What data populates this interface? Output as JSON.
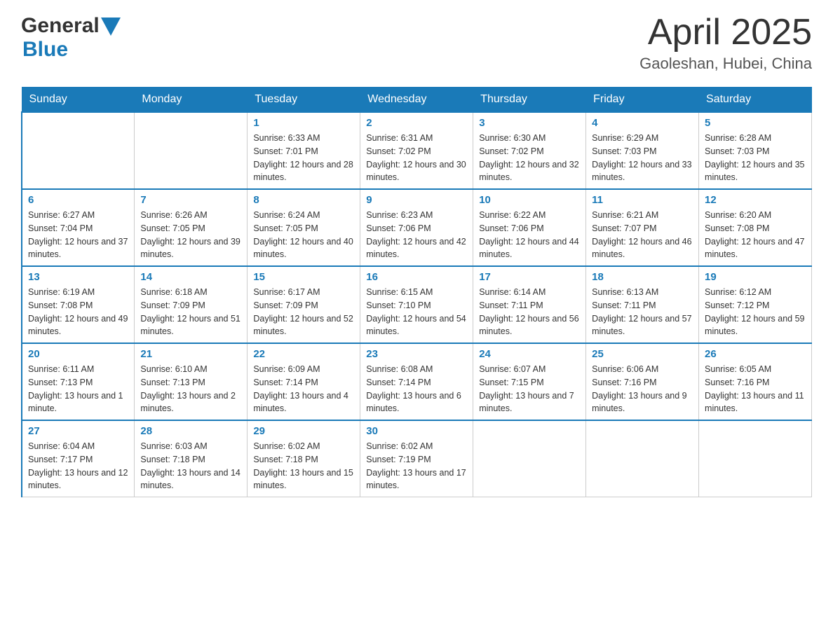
{
  "header": {
    "logo_general": "General",
    "logo_blue": "Blue",
    "title": "April 2025",
    "subtitle": "Gaoleshan, Hubei, China"
  },
  "days_of_week": [
    "Sunday",
    "Monday",
    "Tuesday",
    "Wednesday",
    "Thursday",
    "Friday",
    "Saturday"
  ],
  "weeks": [
    [
      {
        "day": "",
        "sunrise": "",
        "sunset": "",
        "daylight": ""
      },
      {
        "day": "",
        "sunrise": "",
        "sunset": "",
        "daylight": ""
      },
      {
        "day": "1",
        "sunrise": "Sunrise: 6:33 AM",
        "sunset": "Sunset: 7:01 PM",
        "daylight": "Daylight: 12 hours and 28 minutes."
      },
      {
        "day": "2",
        "sunrise": "Sunrise: 6:31 AM",
        "sunset": "Sunset: 7:02 PM",
        "daylight": "Daylight: 12 hours and 30 minutes."
      },
      {
        "day": "3",
        "sunrise": "Sunrise: 6:30 AM",
        "sunset": "Sunset: 7:02 PM",
        "daylight": "Daylight: 12 hours and 32 minutes."
      },
      {
        "day": "4",
        "sunrise": "Sunrise: 6:29 AM",
        "sunset": "Sunset: 7:03 PM",
        "daylight": "Daylight: 12 hours and 33 minutes."
      },
      {
        "day": "5",
        "sunrise": "Sunrise: 6:28 AM",
        "sunset": "Sunset: 7:03 PM",
        "daylight": "Daylight: 12 hours and 35 minutes."
      }
    ],
    [
      {
        "day": "6",
        "sunrise": "Sunrise: 6:27 AM",
        "sunset": "Sunset: 7:04 PM",
        "daylight": "Daylight: 12 hours and 37 minutes."
      },
      {
        "day": "7",
        "sunrise": "Sunrise: 6:26 AM",
        "sunset": "Sunset: 7:05 PM",
        "daylight": "Daylight: 12 hours and 39 minutes."
      },
      {
        "day": "8",
        "sunrise": "Sunrise: 6:24 AM",
        "sunset": "Sunset: 7:05 PM",
        "daylight": "Daylight: 12 hours and 40 minutes."
      },
      {
        "day": "9",
        "sunrise": "Sunrise: 6:23 AM",
        "sunset": "Sunset: 7:06 PM",
        "daylight": "Daylight: 12 hours and 42 minutes."
      },
      {
        "day": "10",
        "sunrise": "Sunrise: 6:22 AM",
        "sunset": "Sunset: 7:06 PM",
        "daylight": "Daylight: 12 hours and 44 minutes."
      },
      {
        "day": "11",
        "sunrise": "Sunrise: 6:21 AM",
        "sunset": "Sunset: 7:07 PM",
        "daylight": "Daylight: 12 hours and 46 minutes."
      },
      {
        "day": "12",
        "sunrise": "Sunrise: 6:20 AM",
        "sunset": "Sunset: 7:08 PM",
        "daylight": "Daylight: 12 hours and 47 minutes."
      }
    ],
    [
      {
        "day": "13",
        "sunrise": "Sunrise: 6:19 AM",
        "sunset": "Sunset: 7:08 PM",
        "daylight": "Daylight: 12 hours and 49 minutes."
      },
      {
        "day": "14",
        "sunrise": "Sunrise: 6:18 AM",
        "sunset": "Sunset: 7:09 PM",
        "daylight": "Daylight: 12 hours and 51 minutes."
      },
      {
        "day": "15",
        "sunrise": "Sunrise: 6:17 AM",
        "sunset": "Sunset: 7:09 PM",
        "daylight": "Daylight: 12 hours and 52 minutes."
      },
      {
        "day": "16",
        "sunrise": "Sunrise: 6:15 AM",
        "sunset": "Sunset: 7:10 PM",
        "daylight": "Daylight: 12 hours and 54 minutes."
      },
      {
        "day": "17",
        "sunrise": "Sunrise: 6:14 AM",
        "sunset": "Sunset: 7:11 PM",
        "daylight": "Daylight: 12 hours and 56 minutes."
      },
      {
        "day": "18",
        "sunrise": "Sunrise: 6:13 AM",
        "sunset": "Sunset: 7:11 PM",
        "daylight": "Daylight: 12 hours and 57 minutes."
      },
      {
        "day": "19",
        "sunrise": "Sunrise: 6:12 AM",
        "sunset": "Sunset: 7:12 PM",
        "daylight": "Daylight: 12 hours and 59 minutes."
      }
    ],
    [
      {
        "day": "20",
        "sunrise": "Sunrise: 6:11 AM",
        "sunset": "Sunset: 7:13 PM",
        "daylight": "Daylight: 13 hours and 1 minute."
      },
      {
        "day": "21",
        "sunrise": "Sunrise: 6:10 AM",
        "sunset": "Sunset: 7:13 PM",
        "daylight": "Daylight: 13 hours and 2 minutes."
      },
      {
        "day": "22",
        "sunrise": "Sunrise: 6:09 AM",
        "sunset": "Sunset: 7:14 PM",
        "daylight": "Daylight: 13 hours and 4 minutes."
      },
      {
        "day": "23",
        "sunrise": "Sunrise: 6:08 AM",
        "sunset": "Sunset: 7:14 PM",
        "daylight": "Daylight: 13 hours and 6 minutes."
      },
      {
        "day": "24",
        "sunrise": "Sunrise: 6:07 AM",
        "sunset": "Sunset: 7:15 PM",
        "daylight": "Daylight: 13 hours and 7 minutes."
      },
      {
        "day": "25",
        "sunrise": "Sunrise: 6:06 AM",
        "sunset": "Sunset: 7:16 PM",
        "daylight": "Daylight: 13 hours and 9 minutes."
      },
      {
        "day": "26",
        "sunrise": "Sunrise: 6:05 AM",
        "sunset": "Sunset: 7:16 PM",
        "daylight": "Daylight: 13 hours and 11 minutes."
      }
    ],
    [
      {
        "day": "27",
        "sunrise": "Sunrise: 6:04 AM",
        "sunset": "Sunset: 7:17 PM",
        "daylight": "Daylight: 13 hours and 12 minutes."
      },
      {
        "day": "28",
        "sunrise": "Sunrise: 6:03 AM",
        "sunset": "Sunset: 7:18 PM",
        "daylight": "Daylight: 13 hours and 14 minutes."
      },
      {
        "day": "29",
        "sunrise": "Sunrise: 6:02 AM",
        "sunset": "Sunset: 7:18 PM",
        "daylight": "Daylight: 13 hours and 15 minutes."
      },
      {
        "day": "30",
        "sunrise": "Sunrise: 6:02 AM",
        "sunset": "Sunset: 7:19 PM",
        "daylight": "Daylight: 13 hours and 17 minutes."
      },
      {
        "day": "",
        "sunrise": "",
        "sunset": "",
        "daylight": ""
      },
      {
        "day": "",
        "sunrise": "",
        "sunset": "",
        "daylight": ""
      },
      {
        "day": "",
        "sunrise": "",
        "sunset": "",
        "daylight": ""
      }
    ]
  ]
}
